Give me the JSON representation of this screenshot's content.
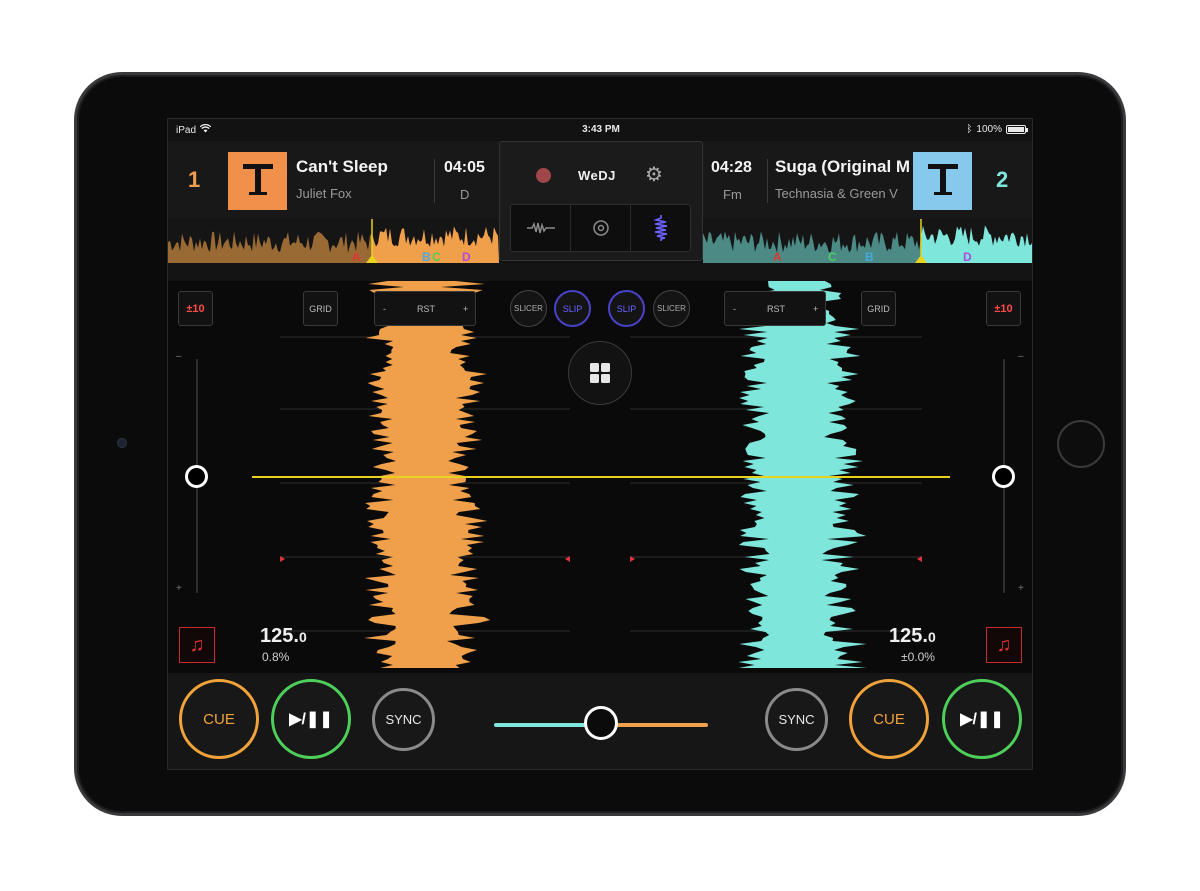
{
  "status": {
    "device": "iPad",
    "time": "3:43 PM",
    "battery": "100%"
  },
  "deck1": {
    "number": "1",
    "title": "Can't Sleep",
    "artist": "Juliet Fox",
    "time": "04:05",
    "key": "D",
    "bpm": "125.",
    "bpm_decimal": "0",
    "pitch": "0.8%",
    "color": "#f0a04a",
    "art_color": "#f0904a",
    "markers": [
      "A",
      "B",
      "C",
      "D"
    ]
  },
  "deck2": {
    "number": "2",
    "title": "Suga (Original M",
    "artist": "Technasia & Green V",
    "time": "04:28",
    "key": "Fm",
    "bpm": "125.",
    "bpm_decimal": "0",
    "pitch": "±0.0%",
    "color": "#7fe6dc",
    "art_color": "#86c9ec",
    "markers": [
      "A",
      "C",
      "B",
      "D"
    ]
  },
  "center": {
    "app_name": "WeDJ",
    "modes": [
      "waveform-mode",
      "jog-mode",
      "vertical-waveform-mode"
    ]
  },
  "controls": {
    "range_left": "±10",
    "range_right": "±10",
    "grid_label": "GRID",
    "rst_label": "RST",
    "minus": "-",
    "plus": "+",
    "slicer_label": "SLICER",
    "slip_label": "SLIP",
    "cue_label": "CUE",
    "play_label": "▶/❚❚",
    "sync_label": "SYNC",
    "slider_minus": "–",
    "slider_plus": "+"
  },
  "crossfader": {
    "position": 0.5
  },
  "colors": {
    "accent_orange": "#f0a04a",
    "accent_cyan": "#7fe6dc",
    "slip_blue": "#4a43c9",
    "cue_orange": "#f0a33a",
    "play_green": "#4ecf5a",
    "playhead_yellow": "#e8d21e"
  }
}
